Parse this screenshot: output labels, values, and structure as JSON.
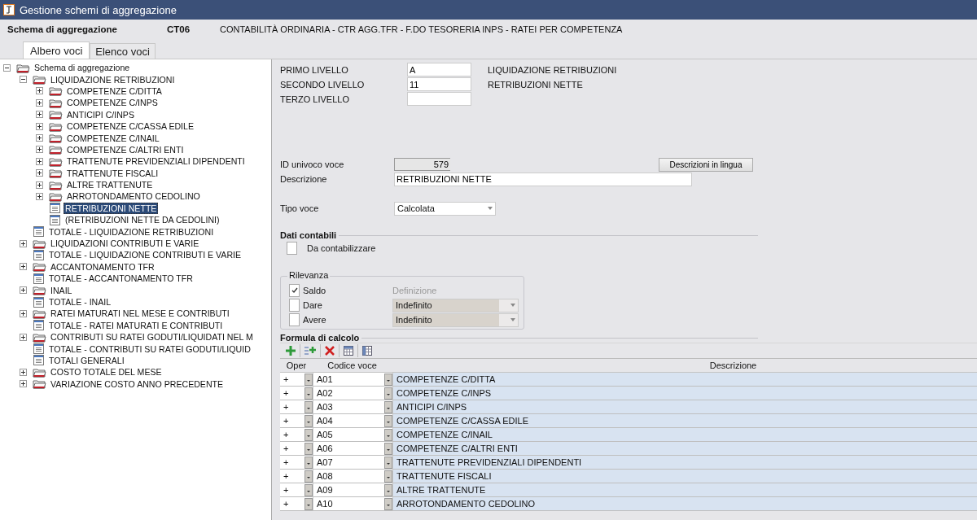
{
  "window": {
    "title": "Gestione schemi di aggregazione"
  },
  "header": {
    "label": "Schema di aggregazione",
    "code": "CT06",
    "description": "CONTABILITÀ ORDINARIA - CTR AGG.TFR - F.DO TESORERIA INPS - RATEI PER COMPETENZA"
  },
  "tabs": [
    {
      "label": "Albero voci",
      "selected": true
    },
    {
      "label": "Elenco voci",
      "selected": false
    }
  ],
  "tree": [
    {
      "label": "Schema di aggregazione",
      "kind": "folder",
      "expanded": true,
      "selected": false,
      "children": [
        {
          "label": "LIQUIDAZIONE RETRIBUZIONI",
          "kind": "folder",
          "expanded": true,
          "selected": false,
          "children": [
            {
              "label": "COMPETENZE C/DITTA",
              "kind": "folder",
              "expanded": false,
              "selected": false
            },
            {
              "label": "COMPETENZE C/INPS",
              "kind": "folder",
              "expanded": false,
              "selected": false
            },
            {
              "label": "ANTICIPI C/INPS",
              "kind": "folder",
              "expanded": false,
              "selected": false
            },
            {
              "label": "COMPETENZE C/CASSA EDILE",
              "kind": "folder",
              "expanded": false,
              "selected": false
            },
            {
              "label": "COMPETENZE C/INAIL",
              "kind": "folder",
              "expanded": false,
              "selected": false
            },
            {
              "label": "COMPETENZE C/ALTRI ENTI",
              "kind": "folder",
              "expanded": false,
              "selected": false
            },
            {
              "label": "TRATTENUTE PREVIDENZIALI DIPENDENTI",
              "kind": "folder",
              "expanded": false,
              "selected": false
            },
            {
              "label": "TRATTENUTE FISCALI",
              "kind": "folder",
              "expanded": false,
              "selected": false
            },
            {
              "label": "ALTRE TRATTENUTE",
              "kind": "folder",
              "expanded": false,
              "selected": false
            },
            {
              "label": "ARROTONDAMENTO CEDOLINO",
              "kind": "folder",
              "expanded": false,
              "selected": false
            },
            {
              "label": "RETRIBUZIONI NETTE",
              "kind": "item",
              "selected": true
            },
            {
              "label": "(RETRIBUZIONI NETTE DA CEDOLINI)",
              "kind": "item",
              "selected": false
            }
          ]
        },
        {
          "label": "TOTALE - LIQUIDAZIONE RETRIBUZIONI",
          "kind": "item",
          "selected": false
        },
        {
          "label": "LIQUIDAZIONI CONTRIBUTI E VARIE",
          "kind": "folder",
          "expanded": false,
          "selected": false
        },
        {
          "label": "TOTALE - LIQUIDAZIONE CONTRIBUTI E VARIE",
          "kind": "item",
          "selected": false
        },
        {
          "label": "ACCANTONAMENTO TFR",
          "kind": "folder",
          "expanded": false,
          "selected": false
        },
        {
          "label": "TOTALE - ACCANTONAMENTO TFR",
          "kind": "item",
          "selected": false
        },
        {
          "label": "INAIL",
          "kind": "folder",
          "expanded": false,
          "selected": false
        },
        {
          "label": "TOTALE - INAIL",
          "kind": "item",
          "selected": false
        },
        {
          "label": "RATEI MATURATI NEL MESE E CONTRIBUTI",
          "kind": "folder",
          "expanded": false,
          "selected": false
        },
        {
          "label": "TOTALE - RATEI MATURATI E CONTRIBUTI",
          "kind": "item",
          "selected": false
        },
        {
          "label": "CONTRIBUTI SU RATEI GODUTI/LIQUIDATI NEL M",
          "kind": "folder",
          "expanded": false,
          "selected": false
        },
        {
          "label": "TOTALE - CONTRIBUTI SU RATEI GODUTI/LIQUID",
          "kind": "item",
          "selected": false
        },
        {
          "label": "TOTALI GENERALI",
          "kind": "item",
          "selected": false
        },
        {
          "label": "COSTO TOTALE DEL MESE",
          "kind": "folder",
          "expanded": false,
          "selected": false
        },
        {
          "label": "VARIAZIONE COSTO ANNO PRECEDENTE",
          "kind": "folder",
          "expanded": false,
          "selected": false
        }
      ]
    }
  ],
  "levels": [
    {
      "label": "PRIMO LIVELLO",
      "value": "A",
      "description": "LIQUIDAZIONE RETRIBUZIONI"
    },
    {
      "label": "SECONDO LIVELLO",
      "value": "11",
      "description": "RETRIBUZIONI NETTE"
    },
    {
      "label": "TERZO LIVELLO"
    }
  ],
  "id_field": {
    "label": "ID univoco voce",
    "value": "579"
  },
  "languages_button": "Descrizioni in lingua",
  "description_field": {
    "label": "Descrizione",
    "value": "RETRIBUZIONI NETTE"
  },
  "type_field": {
    "label": "Tipo voce",
    "value": "Calcolata"
  },
  "accounting": {
    "title": "Dati contabili",
    "checkbox": {
      "label": "Da contabilizzare",
      "checked": false
    }
  },
  "relevance": {
    "title": "Rilevanza",
    "rows": [
      {
        "label": "Saldo",
        "checked": true,
        "note": "Definizione"
      },
      {
        "label": "Dare",
        "checked": false,
        "value": "Indefinito"
      },
      {
        "label": "Avere",
        "checked": false,
        "value": "Indefinito"
      }
    ]
  },
  "formula": {
    "title": "Formula di calcolo",
    "columns": [
      "Oper",
      "Codice voce",
      "Descrizione"
    ],
    "rows": [
      {
        "oper": "+",
        "code": "A01",
        "description": "COMPETENZE C/DITTA"
      },
      {
        "oper": "+",
        "code": "A02",
        "description": "COMPETENZE C/INPS"
      },
      {
        "oper": "+",
        "code": "A03",
        "description": "ANTICIPI C/INPS"
      },
      {
        "oper": "+",
        "code": "A04",
        "description": "COMPETENZE C/CASSA EDILE"
      },
      {
        "oper": "+",
        "code": "A05",
        "description": "COMPETENZE C/INAIL"
      },
      {
        "oper": "+",
        "code": "A06",
        "description": "COMPETENZE C/ALTRI ENTI"
      },
      {
        "oper": "+",
        "code": "A07",
        "description": "TRATTENUTE PREVIDENZIALI DIPENDENTI"
      },
      {
        "oper": "+",
        "code": "A08",
        "description": "TRATTENUTE FISCALI"
      },
      {
        "oper": "+",
        "code": "A09",
        "description": "ALTRE TRATTENUTE"
      },
      {
        "oper": "+",
        "code": "A10",
        "description": "ARROTONDAMENTO CEDOLINO"
      }
    ]
  }
}
